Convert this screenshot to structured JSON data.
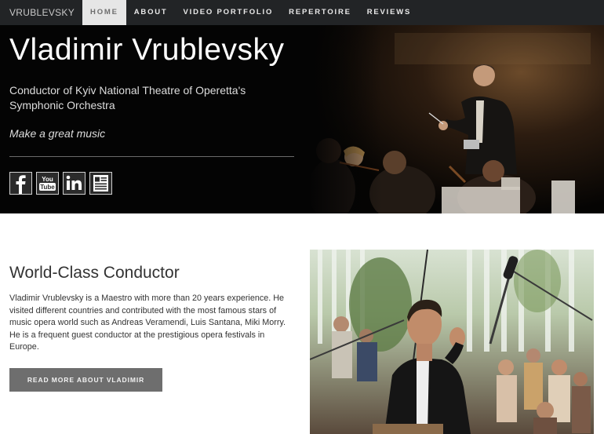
{
  "nav": {
    "brand": "VRUBLEVSKY",
    "items": [
      {
        "label": "HOME",
        "active": true
      },
      {
        "label": "ABOUT"
      },
      {
        "label": "VIDEO PORTFOLIO"
      },
      {
        "label": "REPERTOIRE"
      },
      {
        "label": "REVIEWS"
      }
    ]
  },
  "hero": {
    "title": "Vladimir Vrublevsky",
    "subtitle": "Conductor of Kyiv National Theatre of Operetta's Symphonic Orchestra",
    "tagline": "Make a great music",
    "social": [
      {
        "name": "facebook-icon",
        "glyph": "f"
      },
      {
        "name": "youtube-icon",
        "glyph": "You\nTube"
      },
      {
        "name": "linkedin-icon",
        "glyph": "in"
      },
      {
        "name": "resume-icon"
      }
    ]
  },
  "about": {
    "heading": "World-Class Conductor",
    "text": "Vladimir Vrublevsky is a Maestro with more than 20 years experience. He visited different countries and contributed with the most famous stars of music opera world such as Andreas Veramendi, Luis Santana, Miki Morry. He is a frequent guest conductor at the prestigious opera festivals in Europe.",
    "button_label": "READ MORE ABOUT VLADIMIR"
  },
  "colors": {
    "nav_bg": "#222426",
    "hero_bg": "#040404",
    "button_bg": "#6e6e6e",
    "active_tab_bg": "#e6e6e6"
  }
}
